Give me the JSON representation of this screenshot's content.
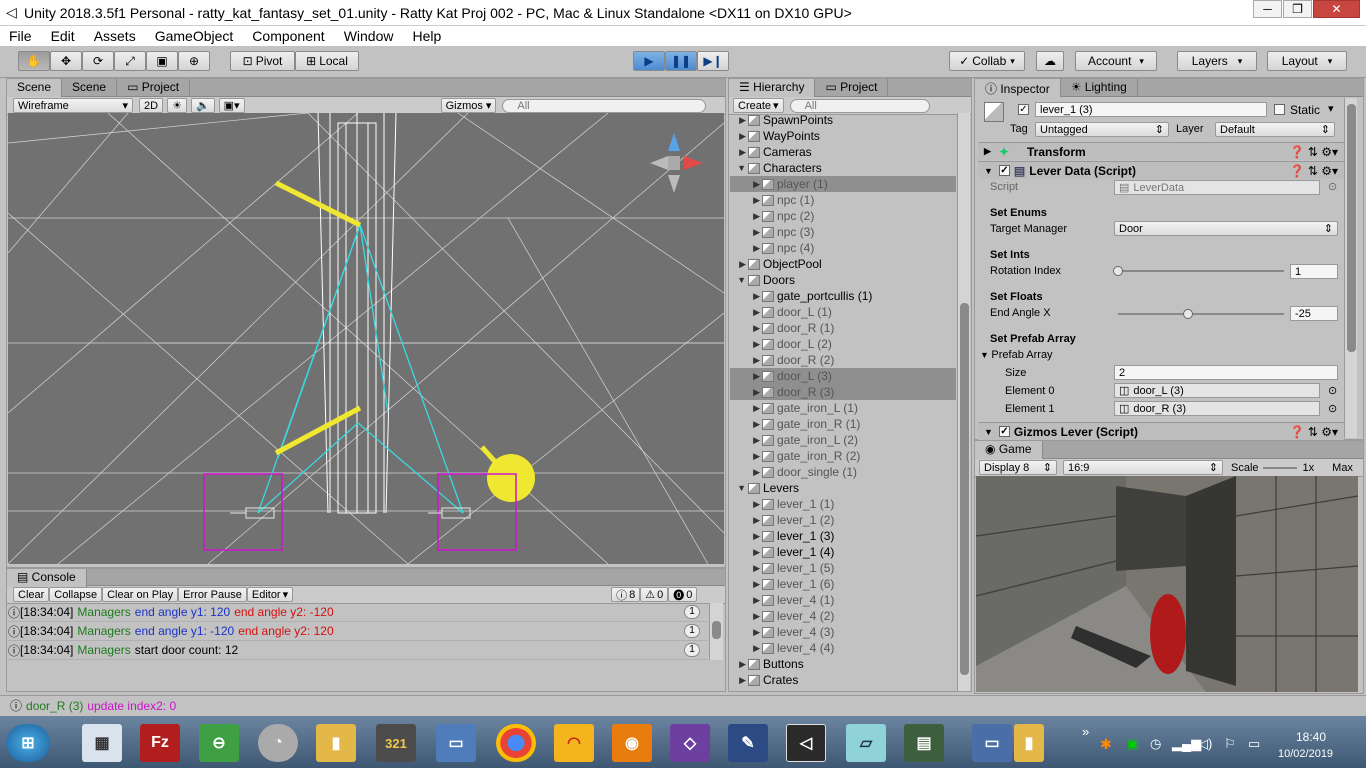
{
  "window": {
    "title": "Unity 2018.3.5f1 Personal - ratty_kat_fantasy_set_01.unity - Ratty Kat Proj 002 - PC, Mac & Linux Standalone <DX11 on DX10 GPU>"
  },
  "menu": [
    "File",
    "Edit",
    "Assets",
    "GameObject",
    "Component",
    "Window",
    "Help"
  ],
  "toolbar": {
    "pivot": "Pivot",
    "local": "Local",
    "collab": "Collab",
    "account": "Account",
    "layers": "Layers",
    "layout": "Layout"
  },
  "scene_panel": {
    "tabs": [
      "Scene",
      "Scene",
      "Project"
    ],
    "shading": "Wireframe",
    "mode_2d": "2D",
    "gizmos": "Gizmos",
    "search_placeholder": "All"
  },
  "hierarchy_panel": {
    "tabs": [
      "Hierarchy",
      "Project"
    ],
    "create": "Create",
    "search_placeholder": "All",
    "items": [
      {
        "label": "SpawnPoints",
        "indent": 0,
        "expanded": false,
        "selected": false,
        "dim": false
      },
      {
        "label": "WayPoints",
        "indent": 0,
        "expanded": false,
        "selected": false,
        "dim": false
      },
      {
        "label": "Cameras",
        "indent": 0,
        "expanded": false,
        "selected": false,
        "dim": false
      },
      {
        "label": "Characters",
        "indent": 0,
        "expanded": true,
        "selected": false,
        "dim": false
      },
      {
        "label": "player (1)",
        "indent": 1,
        "expanded": false,
        "selected": true,
        "dim": true
      },
      {
        "label": "npc (1)",
        "indent": 1,
        "expanded": false,
        "selected": false,
        "dim": true
      },
      {
        "label": "npc (2)",
        "indent": 1,
        "expanded": false,
        "selected": false,
        "dim": true
      },
      {
        "label": "npc (3)",
        "indent": 1,
        "expanded": false,
        "selected": false,
        "dim": true
      },
      {
        "label": "npc (4)",
        "indent": 1,
        "expanded": false,
        "selected": false,
        "dim": true
      },
      {
        "label": "ObjectPool",
        "indent": 0,
        "expanded": false,
        "selected": false,
        "dim": false
      },
      {
        "label": "Doors",
        "indent": 0,
        "expanded": true,
        "selected": false,
        "dim": false
      },
      {
        "label": "gate_portcullis (1)",
        "indent": 1,
        "expanded": false,
        "selected": false,
        "dim": false
      },
      {
        "label": "door_L (1)",
        "indent": 1,
        "expanded": false,
        "selected": false,
        "dim": true
      },
      {
        "label": "door_R (1)",
        "indent": 1,
        "expanded": false,
        "selected": false,
        "dim": true
      },
      {
        "label": "door_L (2)",
        "indent": 1,
        "expanded": false,
        "selected": false,
        "dim": true
      },
      {
        "label": "door_R (2)",
        "indent": 1,
        "expanded": false,
        "selected": false,
        "dim": true
      },
      {
        "label": "door_L (3)",
        "indent": 1,
        "expanded": false,
        "selected": true,
        "dim": true
      },
      {
        "label": "door_R (3)",
        "indent": 1,
        "expanded": false,
        "selected": true,
        "dim": true
      },
      {
        "label": "gate_iron_L (1)",
        "indent": 1,
        "expanded": false,
        "selected": false,
        "dim": true
      },
      {
        "label": "gate_iron_R (1)",
        "indent": 1,
        "expanded": false,
        "selected": false,
        "dim": true
      },
      {
        "label": "gate_iron_L (2)",
        "indent": 1,
        "expanded": false,
        "selected": false,
        "dim": true
      },
      {
        "label": "gate_iron_R (2)",
        "indent": 1,
        "expanded": false,
        "selected": false,
        "dim": true
      },
      {
        "label": "door_single (1)",
        "indent": 1,
        "expanded": false,
        "selected": false,
        "dim": true
      },
      {
        "label": "Levers",
        "indent": 0,
        "expanded": true,
        "selected": false,
        "dim": false
      },
      {
        "label": "lever_1 (1)",
        "indent": 1,
        "expanded": false,
        "selected": false,
        "dim": true
      },
      {
        "label": "lever_1 (2)",
        "indent": 1,
        "expanded": false,
        "selected": false,
        "dim": true
      },
      {
        "label": "lever_1 (3)",
        "indent": 1,
        "expanded": false,
        "selected": false,
        "dim": false
      },
      {
        "label": "lever_1 (4)",
        "indent": 1,
        "expanded": false,
        "selected": false,
        "dim": false
      },
      {
        "label": "lever_1 (5)",
        "indent": 1,
        "expanded": false,
        "selected": false,
        "dim": true
      },
      {
        "label": "lever_1 (6)",
        "indent": 1,
        "expanded": false,
        "selected": false,
        "dim": true
      },
      {
        "label": "lever_4 (1)",
        "indent": 1,
        "expanded": false,
        "selected": false,
        "dim": true
      },
      {
        "label": "lever_4 (2)",
        "indent": 1,
        "expanded": false,
        "selected": false,
        "dim": true
      },
      {
        "label": "lever_4 (3)",
        "indent": 1,
        "expanded": false,
        "selected": false,
        "dim": true
      },
      {
        "label": "lever_4 (4)",
        "indent": 1,
        "expanded": false,
        "selected": false,
        "dim": true
      },
      {
        "label": "Buttons",
        "indent": 0,
        "expanded": false,
        "selected": false,
        "dim": false
      },
      {
        "label": "Crates",
        "indent": 0,
        "expanded": false,
        "selected": false,
        "dim": false
      }
    ]
  },
  "inspector": {
    "tabs": [
      "Inspector",
      "Lighting"
    ],
    "object_name": "lever_1 (3)",
    "static_label": "Static",
    "tag_label": "Tag",
    "tag_value": "Untagged",
    "layer_label": "Layer",
    "layer_value": "Default",
    "transform": "Transform",
    "component": "Lever Data (Script)",
    "script_label": "Script",
    "script_value": "LeverData",
    "enums_header": "Set Enums",
    "target_manager_label": "Target Manager",
    "target_manager_value": "Door",
    "ints_header": "Set Ints",
    "rotation_index_label": "Rotation Index",
    "rotation_index_value": "1",
    "floats_header": "Set Floats",
    "end_angle_label": "End Angle X",
    "end_angle_value": "-25",
    "prefab_header": "Set Prefab Array",
    "prefab_array_label": "Prefab Array",
    "size_label": "Size",
    "size_value": "2",
    "element0_label": "Element 0",
    "element0_value": "door_L (3)",
    "element1_label": "Element 1",
    "element1_value": "door_R (3)",
    "gizmos_component": "Gizmos Lever (Script)"
  },
  "game_panel": {
    "tab": "Game",
    "display": "Display 8",
    "aspect": "16:9",
    "scale_label": "Scale",
    "scale_value": "1x",
    "max": "Max"
  },
  "console": {
    "tab": "Console",
    "buttons": [
      "Clear",
      "Collapse",
      "Clear on Play",
      "Error Pause",
      "Editor"
    ],
    "counts": {
      "info": "8",
      "warn": "0",
      "error": "0"
    },
    "rows": [
      {
        "time": "[18:34:04]",
        "a": "Managers",
        "b": "end angle y1: 120",
        "c": "end angle y2: -120",
        "count": "1"
      },
      {
        "time": "[18:34:04]",
        "a": "Managers",
        "b": "end angle y1: -120",
        "c": "end angle y2: 120",
        "count": "1"
      },
      {
        "time": "[18:34:04]",
        "a": "Managers",
        "b": "start door count: 12",
        "c": "",
        "count": "1"
      }
    ]
  },
  "status": {
    "a": "door_R (3)",
    "b": "update index2: 0"
  },
  "taskbar": {
    "time": "18:40",
    "date": "10/02/2019"
  }
}
